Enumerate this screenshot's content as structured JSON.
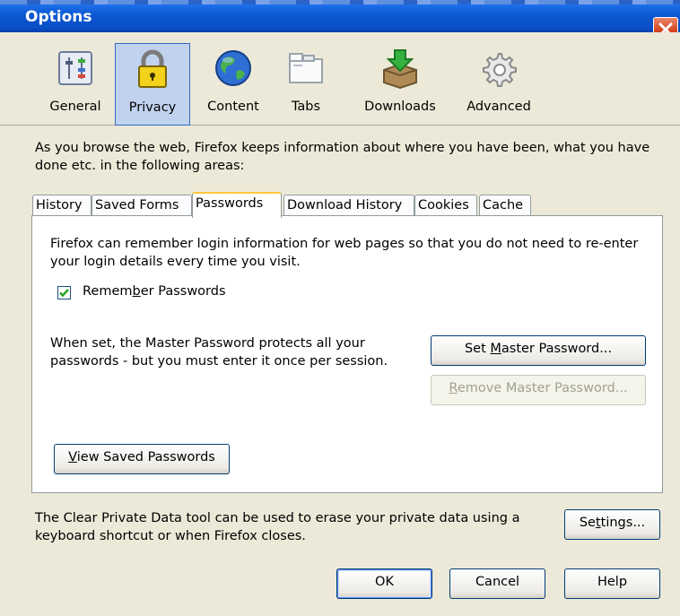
{
  "window": {
    "title": "Options"
  },
  "toolbar": {
    "panes": [
      {
        "label": "General",
        "icon": "general-icon"
      },
      {
        "label": "Privacy",
        "icon": "padlock-icon",
        "selected": true
      },
      {
        "label": "Content",
        "icon": "globe-icon"
      },
      {
        "label": "Tabs",
        "icon": "tabs-icon"
      },
      {
        "label": "Downloads",
        "icon": "downloads-icon"
      },
      {
        "label": "Advanced",
        "icon": "gear-icon"
      }
    ]
  },
  "privacy": {
    "intro": "As you browse the web, Firefox keeps information about where you have been, what you have done etc. in the following areas:",
    "tabs": [
      "History",
      "Saved Forms",
      "Passwords",
      "Download History",
      "Cookies",
      "Cache"
    ],
    "active_tab": "Passwords",
    "passwords": {
      "description": "Firefox can remember login information for web pages so that you do not need to re-enter your login details every time you visit.",
      "remember_pre": "Remem",
      "remember_key": "b",
      "remember_post": "er Passwords",
      "remember_checked": true,
      "master_text": "When set, the Master Password protects all your passwords - but you must enter it once per session.",
      "set_master_pre": "Set ",
      "set_master_key": "M",
      "set_master_post": "aster Password...",
      "remove_master_key": "R",
      "remove_master_post": "emove Master Password...",
      "view_key": "V",
      "view_post": "iew Saved Passwords"
    },
    "clear_private": {
      "text": "The Clear Private Data tool can be used to erase your private data using a keyboard shortcut or when Firefox closes.",
      "settings_pre": "Se",
      "settings_key": "t",
      "settings_post": "tings..."
    }
  },
  "buttons": {
    "ok": "OK",
    "cancel": "Cancel",
    "help": "Help"
  },
  "colors": {
    "titlebar": "#0a4fc6",
    "close": "#d4431e",
    "selected_pane": "#c1d2ee",
    "tab_highlight": "#ffc83c"
  }
}
